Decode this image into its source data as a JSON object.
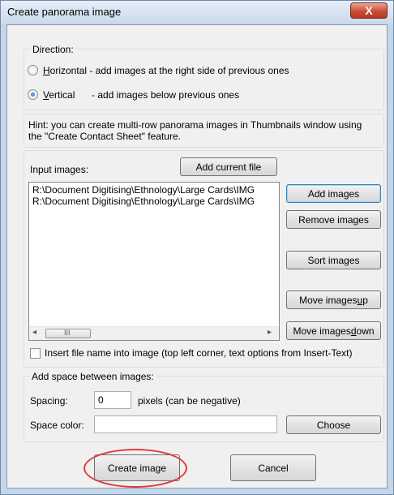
{
  "window": {
    "title": "Create panorama image",
    "close_glyph": "X"
  },
  "direction": {
    "label": "Direction:",
    "horizontal": {
      "key": "H",
      "rest": "orizontal - add images at the right side of previous ones",
      "selected": false
    },
    "vertical": {
      "key": "V",
      "rest": "ertical",
      "desc": "- add images below previous ones",
      "selected": true
    }
  },
  "hint": {
    "line1": "Hint: you can create multi-row panorama images in Thumbnails window using",
    "line2": "the \"Create Contact Sheet\" feature."
  },
  "input_images": {
    "label": "Input images:",
    "add_current_file": "Add current file",
    "files": [
      "R:\\Document Digitising\\Ethnology\\Large Cards\\IMG",
      "R:\\Document Digitising\\Ethnology\\Large Cards\\IMG"
    ],
    "scroll_left": "◂",
    "scroll_right": "▸",
    "thumb_grip": "III",
    "add_images": "Add images",
    "remove_images": "Remove images",
    "sort_images": "Sort images",
    "move_up": {
      "pre": "Move images ",
      "key": "u",
      "post": "p"
    },
    "move_down": {
      "pre": "Move images ",
      "key": "d",
      "post": "own"
    },
    "insert_filename": {
      "label": "Insert file name into image (top left corner, text options from Insert-Text)",
      "checked": false
    }
  },
  "spacing": {
    "label": "Add space between images:",
    "spacing_label": "Spacing:",
    "spacing_value": "0",
    "spacing_hint": "pixels (can be negative)",
    "space_color_label": "Space color:",
    "space_color_value": "",
    "choose": "Choose"
  },
  "footer": {
    "create_image": "Create image",
    "cancel": "Cancel"
  },
  "colors": {
    "annotation": "#e03a3a",
    "title_bar": "#cbdaec",
    "close_button": "#cc4b33"
  }
}
